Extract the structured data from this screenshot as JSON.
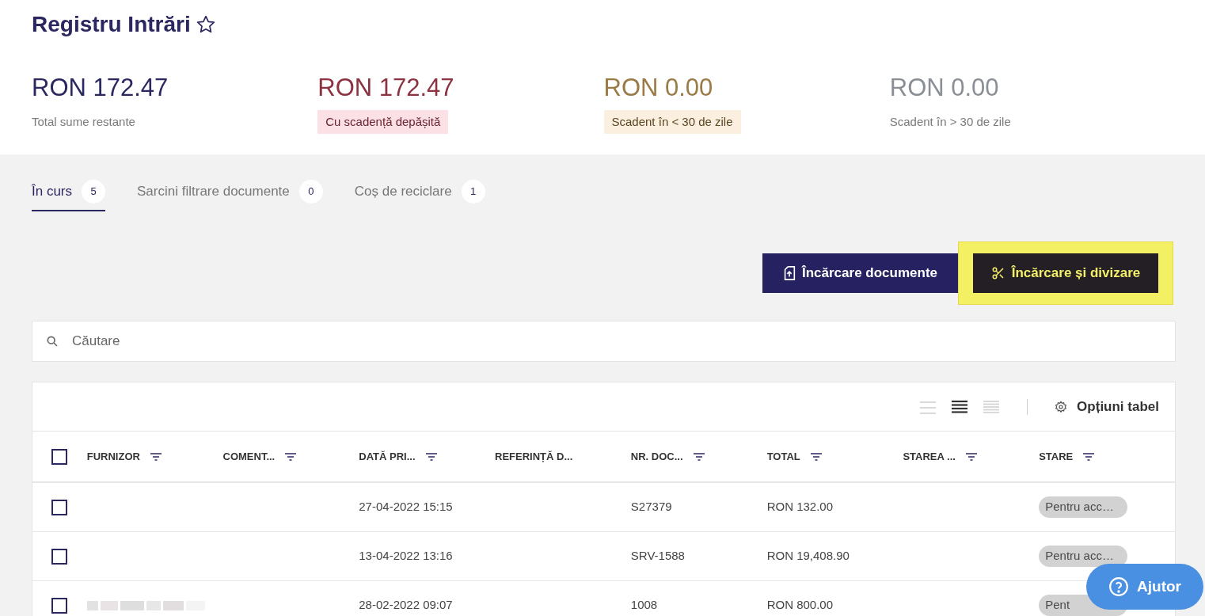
{
  "page": {
    "title": "Registru Intrări",
    "favorite": false
  },
  "summary": [
    {
      "kind": "total",
      "amount": "RON 172.47",
      "label": "Total sume restante"
    },
    {
      "kind": "overdue",
      "amount": "RON 172.47",
      "label": "Cu scadență depășită"
    },
    {
      "kind": "soon",
      "amount": "RON 0.00",
      "label": "Scadent în < 30 de zile"
    },
    {
      "kind": "later",
      "amount": "RON 0.00",
      "label": "Scadent în > 30 de zile"
    }
  ],
  "tabs": [
    {
      "label": "În curs",
      "count": "5",
      "selected": true
    },
    {
      "label": "Sarcini filtrare documente",
      "count": "0",
      "selected": false
    },
    {
      "label": "Coș de reciclare",
      "count": "1",
      "selected": false
    }
  ],
  "actions": [
    {
      "kind": "upload",
      "label": "Încărcare documente",
      "highlighted": false
    },
    {
      "kind": "split",
      "label": "Încărcare și divizare",
      "highlighted": true
    }
  ],
  "search": {
    "placeholder": "Căutare"
  },
  "table": {
    "view_modes": [
      {
        "kind": "loose",
        "selected": false
      },
      {
        "kind": "normal",
        "selected": true
      },
      {
        "kind": "compact",
        "selected": false
      }
    ],
    "options_label": "Opțiuni tabel",
    "select_all": {
      "checked": false
    },
    "columns": [
      {
        "label": "FURNIZOR",
        "filter": true
      },
      {
        "label": "COMENT...",
        "filter": true
      },
      {
        "label": "DATĂ PRI...",
        "filter": true
      },
      {
        "label": "REFERINȚĂ D...",
        "filter": false
      },
      {
        "label": "NR. DOC...",
        "filter": true
      },
      {
        "label": "TOTAL",
        "filter": true
      },
      {
        "label": "STAREA ...",
        "filter": true
      },
      {
        "label": "STARE",
        "filter": true
      }
    ],
    "rows": [
      {
        "checked": false,
        "supplier_blurred": false,
        "date": "27-04-2022 15:15",
        "doc_no": "S27379",
        "total": "RON 132.00",
        "status": "Pentru acc…"
      },
      {
        "checked": false,
        "supplier_blurred": false,
        "date": "13-04-2022 13:16",
        "doc_no": "SRV-1588",
        "total": "RON 19,408.90",
        "status": "Pentru acc…"
      },
      {
        "checked": false,
        "supplier_blurred": true,
        "date": "28-02-2022 09:07",
        "doc_no": "1008",
        "total": "RON 800.00",
        "status": "Pent"
      }
    ]
  },
  "help_button": {
    "label": "Ajutor"
  }
}
